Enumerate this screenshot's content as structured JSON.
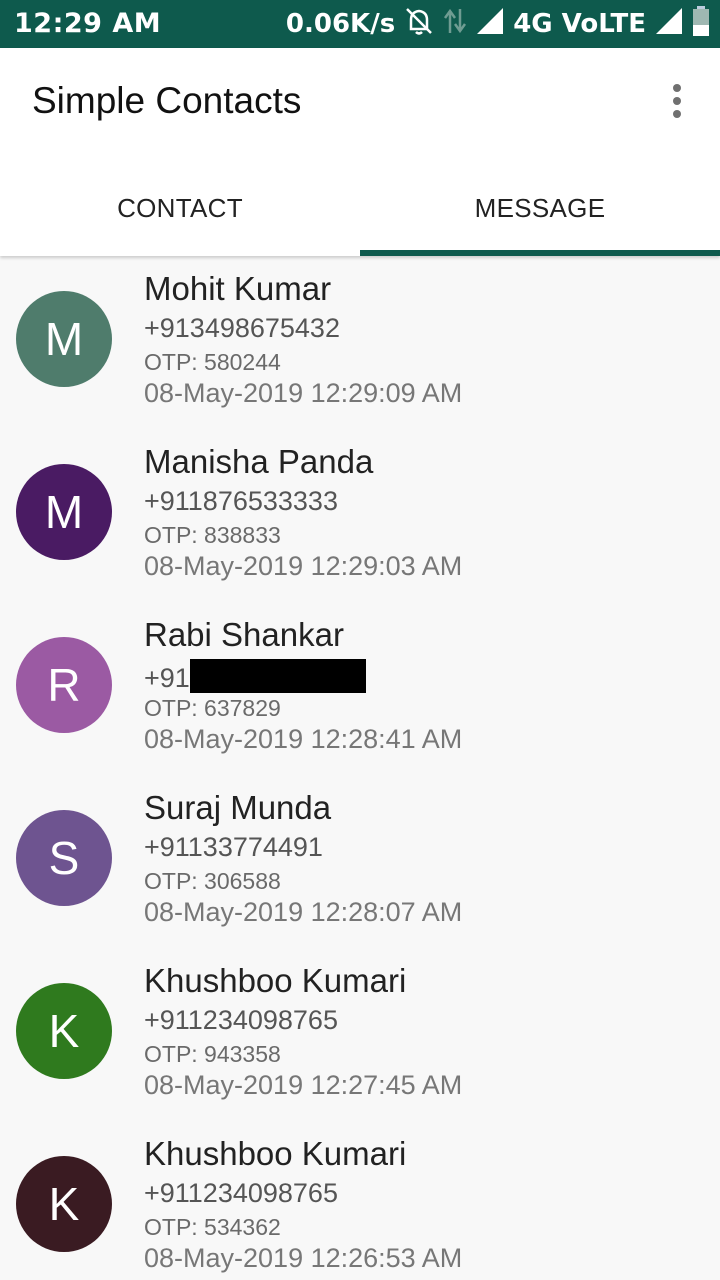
{
  "status_bar": {
    "time": "12:29 AM",
    "speed": "0.06K/s",
    "network": "4G VoLTE",
    "icons": [
      "bell-off-icon",
      "data-arrows-icon",
      "signal-icon",
      "signal-icon",
      "battery-icon"
    ]
  },
  "app_bar": {
    "title": "Simple Contacts",
    "overflow_icon": "more-vert-icon"
  },
  "tabs": [
    {
      "label": "CONTACT",
      "active": false
    },
    {
      "label": "MESSAGE",
      "active": true
    }
  ],
  "accent_color": "#0e5a4d",
  "messages": [
    {
      "initial": "M",
      "name": "Mohit Kumar",
      "phone": "+913498675432",
      "otp": "OTP: 580244",
      "time": "08-May-2019 12:29:09 AM",
      "color": "#4f7c6c"
    },
    {
      "initial": "M",
      "name": "Manisha Panda",
      "phone": "+911876533333",
      "otp": "OTP: 838833",
      "time": "08-May-2019 12:29:03 AM",
      "color": "#4a1b63"
    },
    {
      "initial": "R",
      "name": "Rabi Shankar",
      "phone": "+91",
      "phone_redacted": true,
      "otp": "OTP: 637829",
      "time": "08-May-2019 12:28:41 AM",
      "color": "#9b5aa3"
    },
    {
      "initial": "S",
      "name": "Suraj Munda",
      "phone": "+91133774491",
      "otp": "OTP: 306588",
      "time": "08-May-2019 12:28:07 AM",
      "color": "#6e5490"
    },
    {
      "initial": "K",
      "name": "Khushboo Kumari",
      "phone": "+911234098765",
      "otp": "OTP: 943358",
      "time": "08-May-2019 12:27:45 AM",
      "color": "#2f7a1e"
    },
    {
      "initial": "K",
      "name": "Khushboo Kumari",
      "phone": "+911234098765",
      "otp": "OTP: 534362",
      "time": "08-May-2019 12:26:53 AM",
      "color": "#3a1b22"
    }
  ]
}
